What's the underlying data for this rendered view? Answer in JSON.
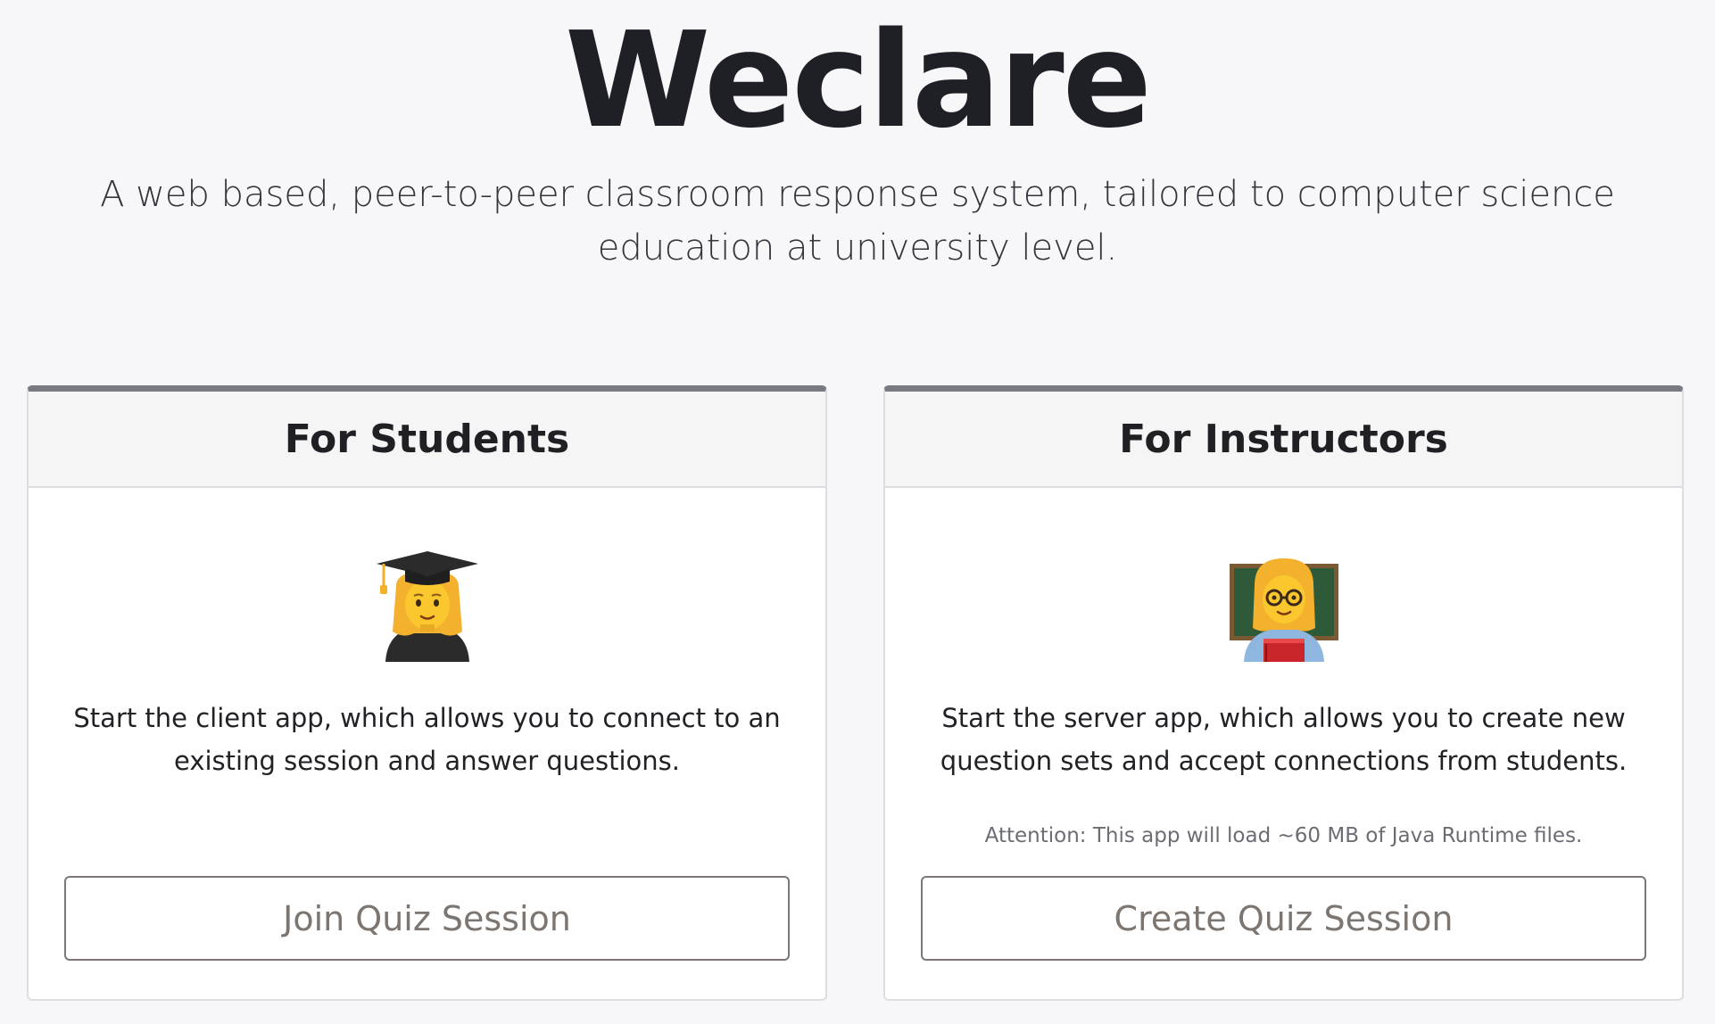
{
  "header": {
    "title": "Weclare",
    "subtitle": "A web based, peer-to-peer classroom response system, tailored to computer science education at university level."
  },
  "cards": [
    {
      "heading": "For Students",
      "icon": "woman-student-emoji",
      "description": "Start the client app, which allows you to connect to an existing session and answer questions.",
      "note": "",
      "button_label": "Join Quiz Session"
    },
    {
      "heading": "For Instructors",
      "icon": "woman-teacher-emoji",
      "description": "Start the server app, which allows you to create new question sets and accept connections from students.",
      "note": "Attention: This app will load ~60 MB of Java Runtime files.",
      "button_label": "Create Quiz Session"
    }
  ],
  "colors": {
    "background": "#f7f7f9",
    "card_top_border": "#7a7a82",
    "button_text": "#7d7570",
    "note_text": "#6c6c74"
  }
}
